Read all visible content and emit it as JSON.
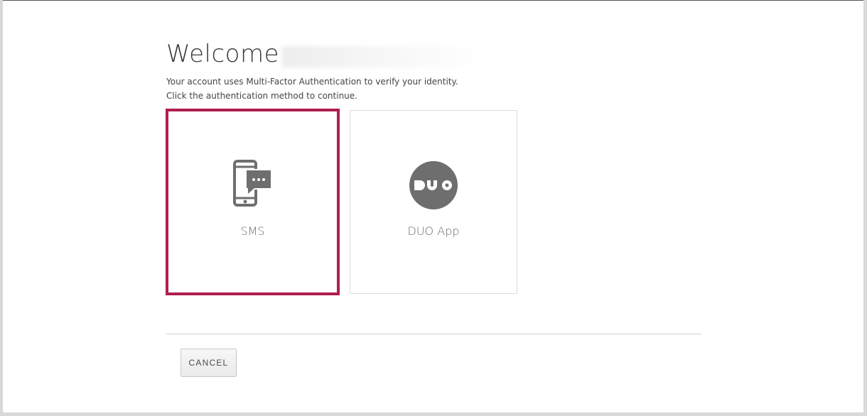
{
  "header": {
    "title": "Welcome"
  },
  "intro": {
    "line1": "Your account uses Multi-Factor Authentication to verify your identity.",
    "line2": "Click the authentication method to continue."
  },
  "methods": [
    {
      "label": "SMS",
      "icon": "sms-phone-icon",
      "selected": true
    },
    {
      "label": "DUO App",
      "icon": "duo-logo-icon",
      "selected": false
    }
  ],
  "actions": {
    "cancel_label": "CANCEL"
  },
  "colors": {
    "selected_border": "#b01e4e",
    "icon_gray": "#6e6e6e"
  }
}
